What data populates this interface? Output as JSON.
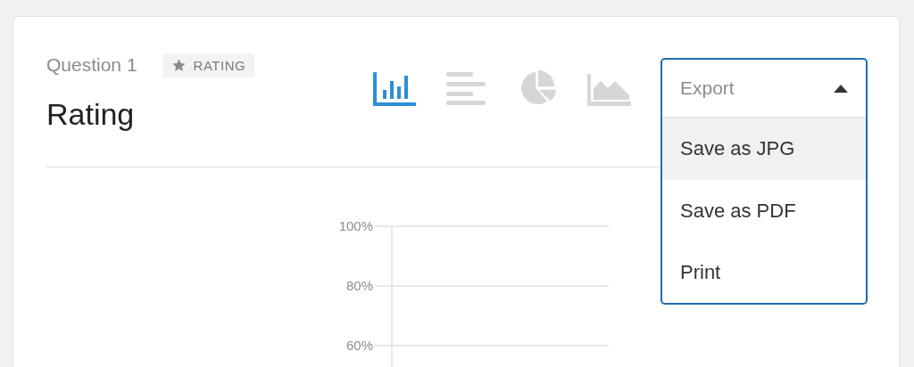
{
  "question": {
    "number": "Question 1",
    "badge": "RATING",
    "title": "Rating"
  },
  "chart_types": [
    {
      "kind": "column",
      "selected": true
    },
    {
      "kind": "bar",
      "selected": false
    },
    {
      "kind": "pie",
      "selected": false
    },
    {
      "kind": "area",
      "selected": false
    }
  ],
  "export_menu": {
    "placeholder": "Export",
    "expanded": true,
    "items": [
      {
        "label": "Save as JPG",
        "selected": true
      },
      {
        "label": "Save as PDF",
        "selected": false
      },
      {
        "label": "Print",
        "selected": false
      }
    ]
  },
  "chart_axis": {
    "y_labels": [
      "100%",
      "80%",
      "60%"
    ]
  }
}
